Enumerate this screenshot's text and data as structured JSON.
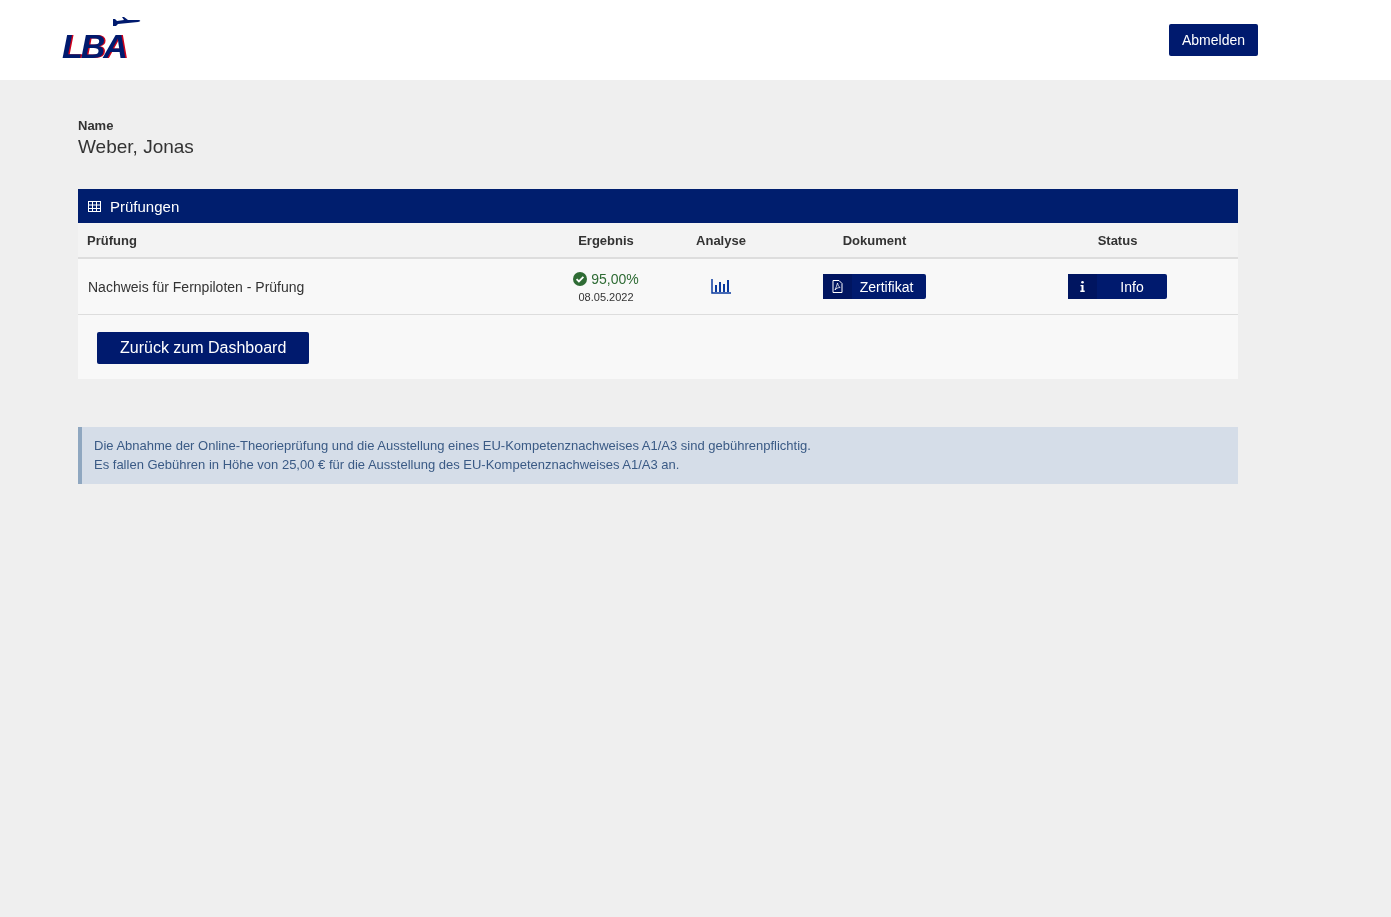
{
  "header": {
    "logo": "LBA",
    "logout_button": "Abmelden"
  },
  "person": {
    "label": "Name",
    "value": "Weber, Jonas"
  },
  "exams": {
    "title": "Prüfungen",
    "columns": [
      "Prüfung",
      "Ergebnis",
      "Analyse",
      "Dokument",
      "Status"
    ],
    "rows": [
      {
        "exam": "Nachweis für Fernpiloten - Prüfung",
        "passed": true,
        "score": "95,00%",
        "date": "08.05.2022",
        "document_button": "Zertifikat",
        "status_button": "Info"
      }
    ],
    "back_button": "Zurück zum Dashboard"
  },
  "notice": [
    "Die Abnahme der Online-Theorieprüfung und die Ausstellung eines EU-Kompetenznachweises A1/A3 sind gebührenpflichtig.",
    "Es fallen Gebühren in Höhe von 25,00 € für die Ausstellung des EU-Kompetenznachweises A1/A3 an."
  ]
}
